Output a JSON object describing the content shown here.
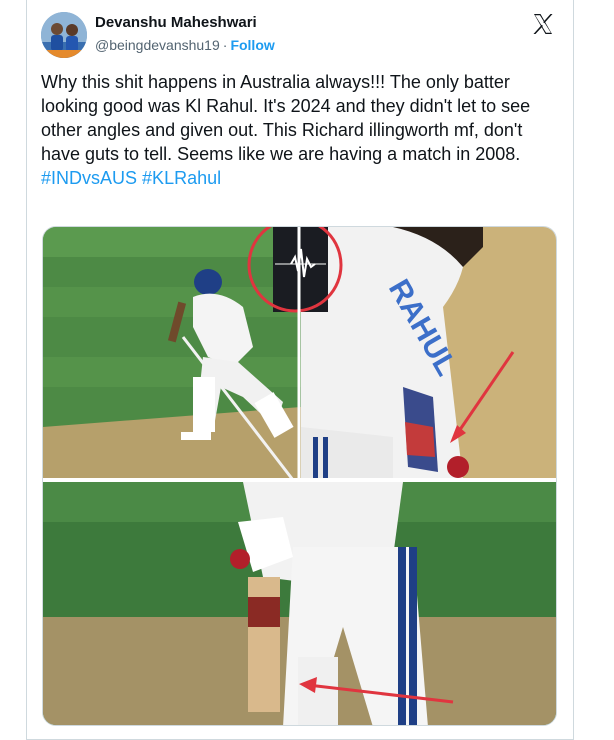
{
  "author": {
    "display_name": "Devanshu Maheshwari",
    "handle": "@beingdevanshu19",
    "separator": "·",
    "follow_label": "Follow"
  },
  "tweet": {
    "text": "Why this shit happens in Australia always!!! The only batter looking good was Kl Rahul. It's 2024 and they didn't let to see other angles and given out. This Richard illingworth mf, don't have guts to tell. Seems like we are having a match in 2008.",
    "hashtags": [
      "#INDvsAUS",
      "#KLRahul"
    ]
  },
  "media": {
    "jersey_text": "RAHUL"
  },
  "colors": {
    "link": "#1d9bf0",
    "annotation_red": "#e0353f",
    "pitch": "#c9b27c",
    "grass": "#3f7b3a"
  },
  "icons": {
    "brand": "x-logo-icon"
  }
}
